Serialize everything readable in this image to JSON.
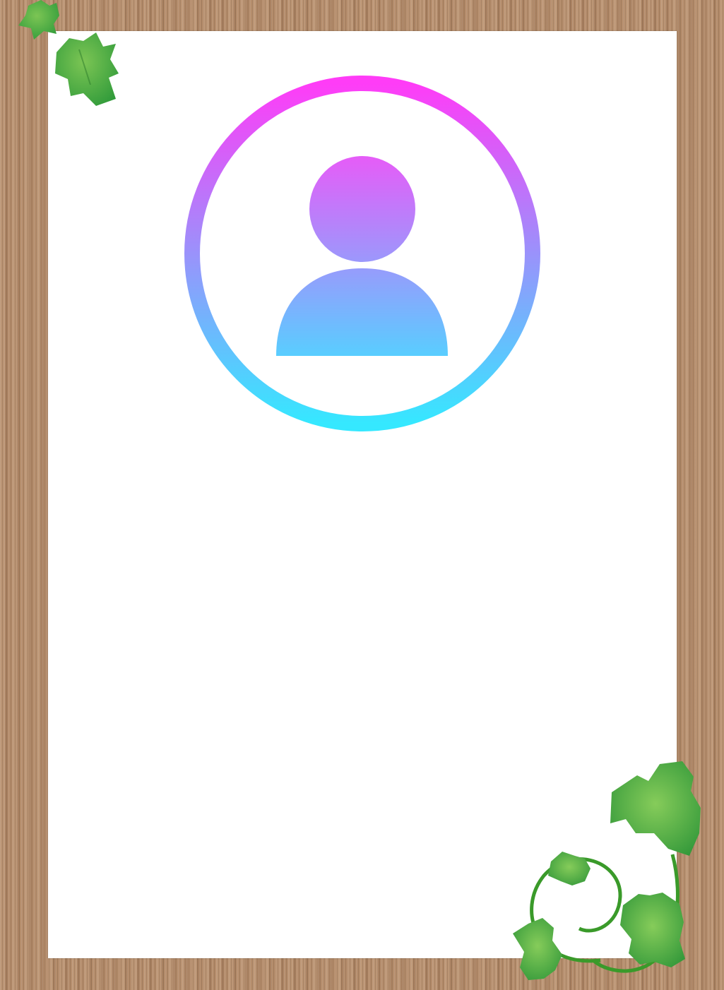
{
  "page": {
    "background": "wood-grain",
    "panel_color": "#ffffff"
  },
  "avatar": {
    "icon": "user-avatar-icon",
    "ring_gradient": [
      "#ff3cf7",
      "#35e8ff"
    ],
    "figure_gradient": [
      "#e45ff9",
      "#5cccff"
    ]
  },
  "decorations": {
    "top_left": "ivy-leaves-icon",
    "bottom_right": "ivy-vine-icon",
    "leaf_colors": [
      "#2f9a3a",
      "#7cc554"
    ],
    "vine_color": "#3a9a2a"
  }
}
